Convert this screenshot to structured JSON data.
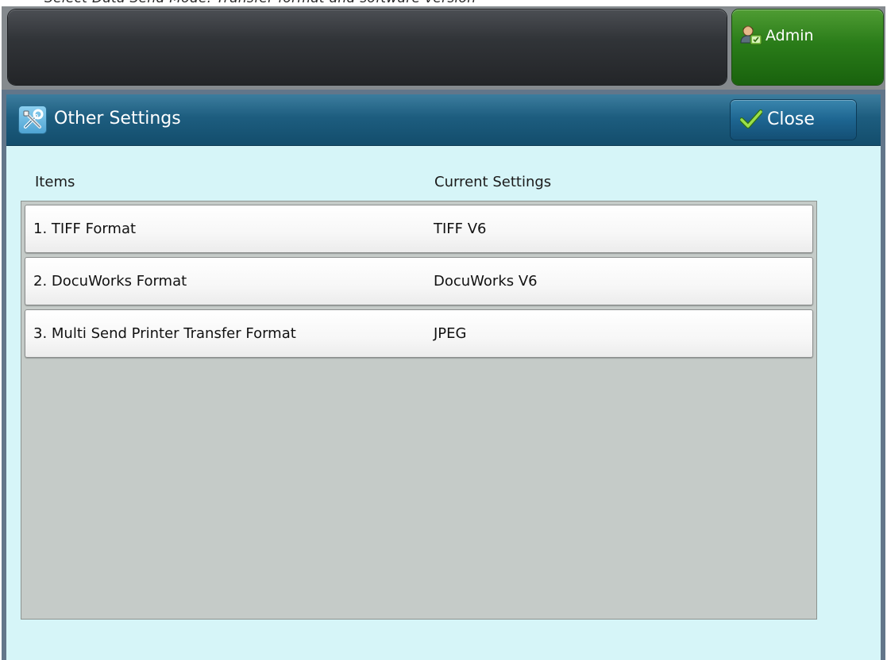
{
  "top_fragment": "• Select Data Send Mode: Transfer format and software version",
  "header": {
    "admin_label": "Admin"
  },
  "panel": {
    "title": "Other Settings",
    "close_label": "Close",
    "columns": {
      "items": "Items",
      "current": "Current Settings"
    },
    "rows": [
      {
        "item": "1. TIFF Format",
        "value": "TIFF V6"
      },
      {
        "item": "2. DocuWorks Format",
        "value": "DocuWorks V6"
      },
      {
        "item": "3. Multi Send Printer Transfer Format",
        "value": "JPEG"
      }
    ]
  },
  "colors": {
    "admin_green": "#2a7c19",
    "title_bar_blue": "#1d5d7f",
    "panel_bg": "#d6f5f8",
    "list_bg": "#c5cbc8"
  },
  "icons": [
    "admin-user-icon",
    "settings-tools-icon",
    "checkmark-icon"
  ]
}
